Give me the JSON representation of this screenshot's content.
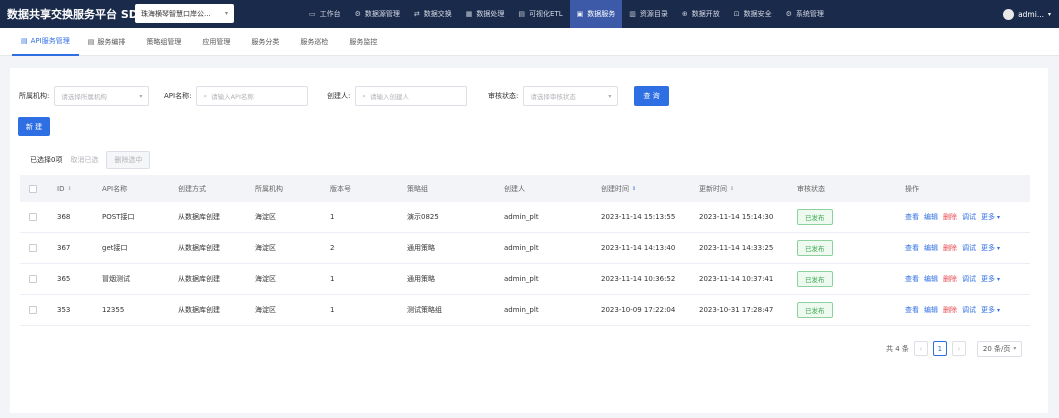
{
  "header": {
    "brand": "数据共享交换服务平台 SDX",
    "org_select": "珠海横琴智慧口岸公...",
    "nav": [
      {
        "icon": "monitor-icon",
        "glyph": "▭",
        "label": "工作台"
      },
      {
        "icon": "gear-icon",
        "glyph": "⚙",
        "label": "数据源管理"
      },
      {
        "icon": "exchange-icon",
        "glyph": "⇄",
        "label": "数据交换"
      },
      {
        "icon": "grid-icon",
        "glyph": "▦",
        "label": "数据处理"
      },
      {
        "icon": "document-icon",
        "glyph": "▤",
        "label": "可视化ETL"
      },
      {
        "icon": "database-icon",
        "glyph": "▣",
        "label": "数据服务",
        "active": true
      },
      {
        "icon": "catalog-icon",
        "glyph": "▥",
        "label": "资源目录"
      },
      {
        "icon": "open-icon",
        "glyph": "⊕",
        "label": "数据开放"
      },
      {
        "icon": "lock-icon",
        "glyph": "⊡",
        "label": "数据安全"
      },
      {
        "icon": "settings-icon",
        "glyph": "⚙",
        "label": "系统管理"
      }
    ],
    "user": "admi..."
  },
  "tabs": [
    {
      "label": "API服务管理",
      "active": true
    },
    {
      "label": "服务编排"
    },
    {
      "label": "策略组管理"
    },
    {
      "label": "应用管理"
    },
    {
      "label": "服务分类"
    },
    {
      "label": "服务巡检"
    },
    {
      "label": "服务监控"
    }
  ],
  "filters": {
    "org_label": "所属机构:",
    "org_placeholder": "请选择所属机构",
    "api_label": "API名称:",
    "api_placeholder": "请输入API名称",
    "creator_label": "创建人:",
    "creator_placeholder": "请输入创建人",
    "status_label": "审核状态:",
    "status_placeholder": "请选择审核状态",
    "query_button": "查 询"
  },
  "new_button": "新 建",
  "selection": {
    "text": "已选择0项",
    "cancel": "取消已选",
    "delete": "删除选中"
  },
  "table": {
    "columns": [
      "ID",
      "API名称",
      "创建方式",
      "所属机构",
      "版本号",
      "策略组",
      "创建人",
      "创建时间",
      "更新时间",
      "审核状态",
      "操作"
    ],
    "rows": [
      {
        "id": "368",
        "name": "POST接口",
        "method": "从数据库创建",
        "org": "海淀区",
        "version": "1",
        "policy": "演示0825",
        "creator": "admin_plt",
        "created": "2023-11-14 15:13:55",
        "updated": "2023-11-14 15:14:30",
        "status": "已发布"
      },
      {
        "id": "367",
        "name": "get接口",
        "method": "从数据库创建",
        "org": "海淀区",
        "version": "2",
        "policy": "通用策略",
        "creator": "admin_plt",
        "created": "2023-11-14 14:13:40",
        "updated": "2023-11-14 14:33:25",
        "status": "已发布"
      },
      {
        "id": "365",
        "name": "冒烟测试",
        "method": "从数据库创建",
        "org": "海淀区",
        "version": "1",
        "policy": "通用策略",
        "creator": "admin_plt",
        "created": "2023-11-14 10:36:52",
        "updated": "2023-11-14 10:37:41",
        "status": "已发布"
      },
      {
        "id": "353",
        "name": "12355",
        "method": "从数据库创建",
        "org": "海淀区",
        "version": "1",
        "policy": "测试策略组",
        "creator": "admin_plt",
        "created": "2023-10-09 17:22:04",
        "updated": "2023-10-31 17:28:47",
        "status": "已发布"
      }
    ],
    "actions": [
      "查看",
      "编辑",
      "删除",
      "调试",
      "更多"
    ]
  },
  "pagination": {
    "total": "共 4 条",
    "current": "1",
    "page_size": "20 条/页"
  },
  "colors": {
    "topbar": "#1a2a4a",
    "accent": "#2f6fe4",
    "published": "#3aa84f",
    "danger": "#e5484d"
  }
}
